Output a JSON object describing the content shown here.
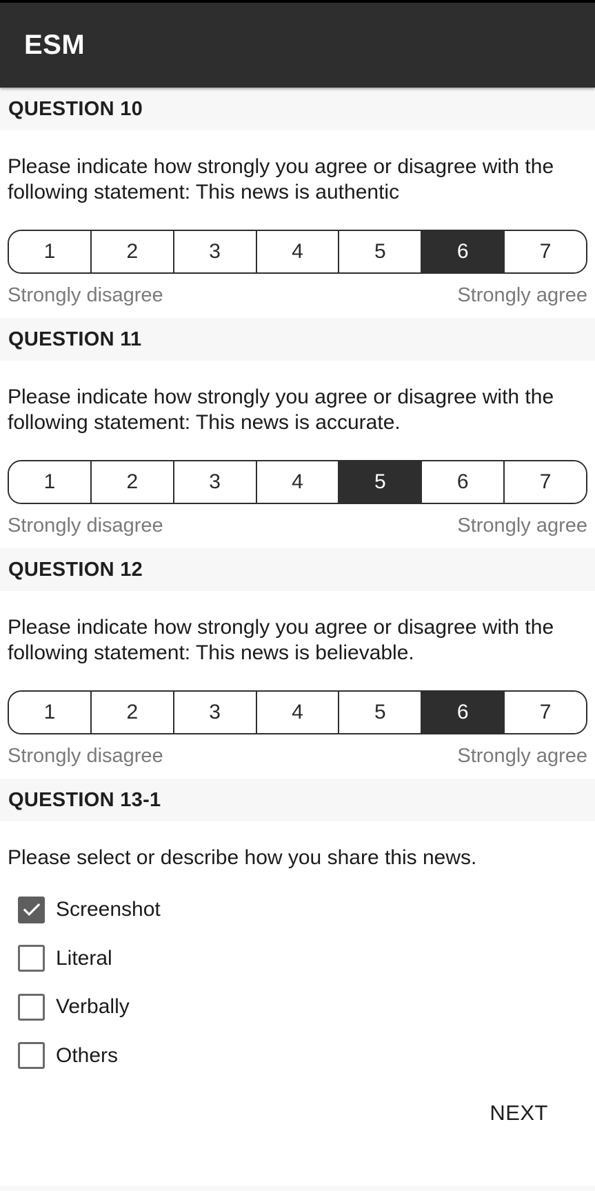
{
  "app": {
    "title": "ESM"
  },
  "questions": [
    {
      "header": "QUESTION 10",
      "text": "Please indicate how strongly you agree or disagree with the following statement: This news is authentic",
      "scale": [
        "1",
        "2",
        "3",
        "4",
        "5",
        "6",
        "7"
      ],
      "selected": 6,
      "min_label": "Strongly disagree",
      "max_label": "Strongly agree"
    },
    {
      "header": "QUESTION 11",
      "text": "Please indicate how strongly you agree or disagree with the following statement: This news is accurate.",
      "scale": [
        "1",
        "2",
        "3",
        "4",
        "5",
        "6",
        "7"
      ],
      "selected": 5,
      "min_label": "Strongly disagree",
      "max_label": "Strongly agree"
    },
    {
      "header": "QUESTION 12",
      "text": "Please indicate how strongly you agree or disagree with the following statement: This news is believable.",
      "scale": [
        "1",
        "2",
        "3",
        "4",
        "5",
        "6",
        "7"
      ],
      "selected": 6,
      "min_label": "Strongly disagree",
      "max_label": "Strongly agree"
    }
  ],
  "share_question": {
    "header": "QUESTION 13-1",
    "text": "Please select or describe how you share this news.",
    "options": [
      {
        "label": "Screenshot",
        "checked": true
      },
      {
        "label": "Literal",
        "checked": false
      },
      {
        "label": "Verbally",
        "checked": false
      },
      {
        "label": "Others",
        "checked": false
      }
    ]
  },
  "footer": {
    "next_label": "NEXT"
  },
  "colors": {
    "appbar": "#2e2e2e",
    "selected_cell": "#2e2e2e",
    "section_header_bg": "#f7f7f7",
    "muted_text": "#7a7a7a",
    "checkbox_checked": "#5e5e5e"
  },
  "icons": {
    "checkbox_checked": "checkmark-icon"
  }
}
